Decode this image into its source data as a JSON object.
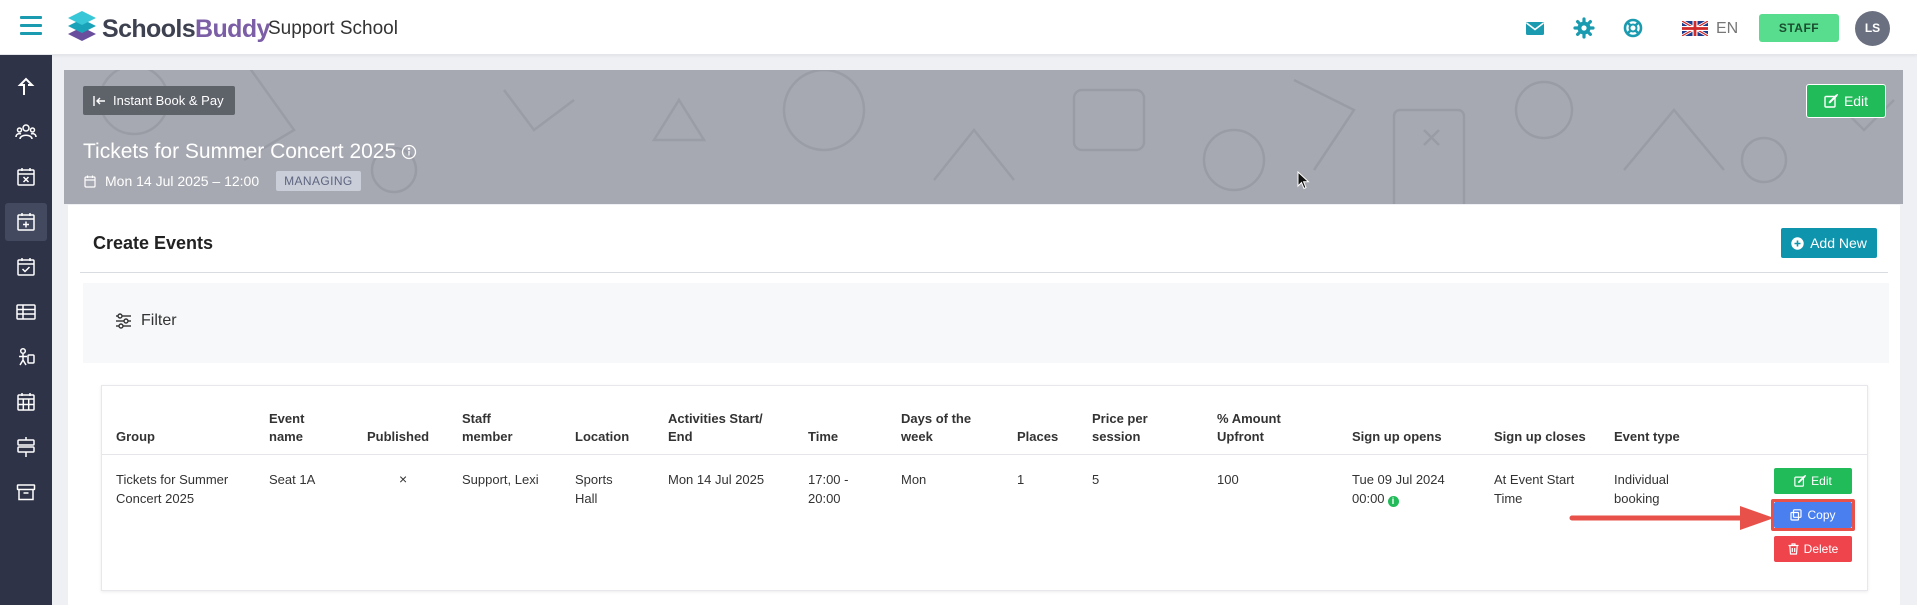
{
  "header": {
    "brand_part1": "Schools",
    "brand_part2": "Buddy",
    "school_name": "Support School",
    "language": "EN",
    "staff_label": "STAFF",
    "avatar_initials": "LS"
  },
  "banner": {
    "back_label": "Instant Book & Pay",
    "edit_label": "Edit",
    "title": "Tickets for Summer Concert 2025",
    "date": "Mon 14 Jul 2025 – 12:00",
    "badge": "MANAGING"
  },
  "content": {
    "title": "Create Events",
    "add_new_label": "Add New",
    "filter_label": "Filter"
  },
  "table": {
    "headers": {
      "group": "Group",
      "event_name": "Event name",
      "published": "Published",
      "staff_member": "Staff member",
      "location": "Location",
      "activities": "Activities Start/ End",
      "time": "Time",
      "days": "Days of the week",
      "places": "Places",
      "price": "Price per session",
      "amount": "% Amount Upfront",
      "signup_opens": "Sign up opens",
      "signup_closes": "Sign up closes",
      "event_type": "Event type"
    },
    "rows": [
      {
        "group": "Tickets for Summer Concert 2025",
        "event_name": "Seat 1A",
        "published": "×",
        "staff_member": "Support, Lexi",
        "location": "Sports Hall",
        "activities": "Mon 14 Jul 2025",
        "time": "17:00 - 20:00",
        "days": "Mon",
        "places": "1",
        "price": "5",
        "amount": "100",
        "signup_opens": "Tue 09 Jul 2024 00:00",
        "signup_closes": "At Event Start Time",
        "event_type": "Individual booking",
        "actions": {
          "edit": "Edit",
          "copy": "Copy",
          "delete": "Delete"
        }
      }
    ]
  },
  "colors": {
    "accent": "#1b9bb0",
    "sidebar": "#2e3347",
    "green": "#22bb5a",
    "blue": "#4a7ff0",
    "red": "#f0444d",
    "highlight": "#e8514a"
  },
  "icons": {
    "topbar": [
      "mail-icon",
      "gear-icon",
      "lifebuoy-icon",
      "uk-flag-icon"
    ],
    "sidebar": [
      "share-icon",
      "users-icon",
      "calendar-cancel-icon",
      "calendar-add-icon",
      "calendar-check-icon",
      "table-icon",
      "person-icon",
      "calendar-grid-icon",
      "signpost-icon",
      "archive-icon"
    ]
  }
}
